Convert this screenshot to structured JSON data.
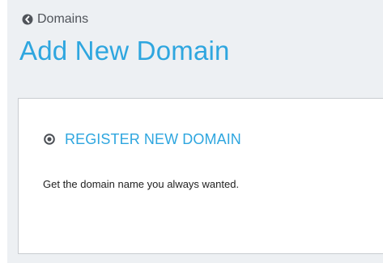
{
  "back_link": {
    "label": "Domains",
    "icon": "chevron-left-circle-icon"
  },
  "page_title": "Add New Domain",
  "options": [
    {
      "icon": "radio-selected-icon",
      "title": "REGISTER NEW DOMAIN",
      "description": "Get the domain name you always wanted."
    }
  ],
  "colors": {
    "accent": "#2ea6df",
    "background": "#edf0f3",
    "panel": "#ffffff",
    "text": "#222222",
    "muted_text": "#50545a",
    "border": "#c8ccd0"
  }
}
